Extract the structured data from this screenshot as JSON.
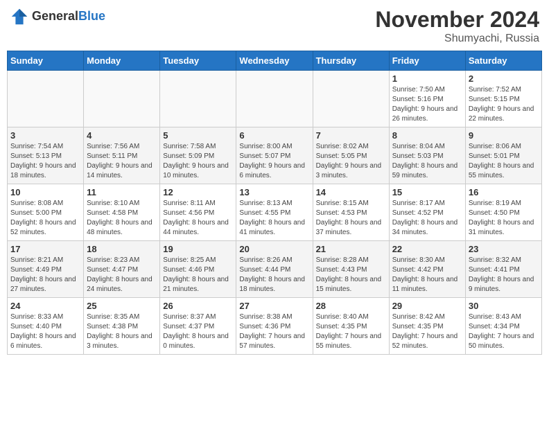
{
  "header": {
    "logo_general": "General",
    "logo_blue": "Blue",
    "month": "November 2024",
    "location": "Shumyachi, Russia"
  },
  "days_of_week": [
    "Sunday",
    "Monday",
    "Tuesday",
    "Wednesday",
    "Thursday",
    "Friday",
    "Saturday"
  ],
  "weeks": [
    [
      {
        "day": "",
        "info": ""
      },
      {
        "day": "",
        "info": ""
      },
      {
        "day": "",
        "info": ""
      },
      {
        "day": "",
        "info": ""
      },
      {
        "day": "",
        "info": ""
      },
      {
        "day": "1",
        "info": "Sunrise: 7:50 AM\nSunset: 5:16 PM\nDaylight: 9 hours and 26 minutes."
      },
      {
        "day": "2",
        "info": "Sunrise: 7:52 AM\nSunset: 5:15 PM\nDaylight: 9 hours and 22 minutes."
      }
    ],
    [
      {
        "day": "3",
        "info": "Sunrise: 7:54 AM\nSunset: 5:13 PM\nDaylight: 9 hours and 18 minutes."
      },
      {
        "day": "4",
        "info": "Sunrise: 7:56 AM\nSunset: 5:11 PM\nDaylight: 9 hours and 14 minutes."
      },
      {
        "day": "5",
        "info": "Sunrise: 7:58 AM\nSunset: 5:09 PM\nDaylight: 9 hours and 10 minutes."
      },
      {
        "day": "6",
        "info": "Sunrise: 8:00 AM\nSunset: 5:07 PM\nDaylight: 9 hours and 6 minutes."
      },
      {
        "day": "7",
        "info": "Sunrise: 8:02 AM\nSunset: 5:05 PM\nDaylight: 9 hours and 3 minutes."
      },
      {
        "day": "8",
        "info": "Sunrise: 8:04 AM\nSunset: 5:03 PM\nDaylight: 8 hours and 59 minutes."
      },
      {
        "day": "9",
        "info": "Sunrise: 8:06 AM\nSunset: 5:01 PM\nDaylight: 8 hours and 55 minutes."
      }
    ],
    [
      {
        "day": "10",
        "info": "Sunrise: 8:08 AM\nSunset: 5:00 PM\nDaylight: 8 hours and 52 minutes."
      },
      {
        "day": "11",
        "info": "Sunrise: 8:10 AM\nSunset: 4:58 PM\nDaylight: 8 hours and 48 minutes."
      },
      {
        "day": "12",
        "info": "Sunrise: 8:11 AM\nSunset: 4:56 PM\nDaylight: 8 hours and 44 minutes."
      },
      {
        "day": "13",
        "info": "Sunrise: 8:13 AM\nSunset: 4:55 PM\nDaylight: 8 hours and 41 minutes."
      },
      {
        "day": "14",
        "info": "Sunrise: 8:15 AM\nSunset: 4:53 PM\nDaylight: 8 hours and 37 minutes."
      },
      {
        "day": "15",
        "info": "Sunrise: 8:17 AM\nSunset: 4:52 PM\nDaylight: 8 hours and 34 minutes."
      },
      {
        "day": "16",
        "info": "Sunrise: 8:19 AM\nSunset: 4:50 PM\nDaylight: 8 hours and 31 minutes."
      }
    ],
    [
      {
        "day": "17",
        "info": "Sunrise: 8:21 AM\nSunset: 4:49 PM\nDaylight: 8 hours and 27 minutes."
      },
      {
        "day": "18",
        "info": "Sunrise: 8:23 AM\nSunset: 4:47 PM\nDaylight: 8 hours and 24 minutes."
      },
      {
        "day": "19",
        "info": "Sunrise: 8:25 AM\nSunset: 4:46 PM\nDaylight: 8 hours and 21 minutes."
      },
      {
        "day": "20",
        "info": "Sunrise: 8:26 AM\nSunset: 4:44 PM\nDaylight: 8 hours and 18 minutes."
      },
      {
        "day": "21",
        "info": "Sunrise: 8:28 AM\nSunset: 4:43 PM\nDaylight: 8 hours and 15 minutes."
      },
      {
        "day": "22",
        "info": "Sunrise: 8:30 AM\nSunset: 4:42 PM\nDaylight: 8 hours and 11 minutes."
      },
      {
        "day": "23",
        "info": "Sunrise: 8:32 AM\nSunset: 4:41 PM\nDaylight: 8 hours and 9 minutes."
      }
    ],
    [
      {
        "day": "24",
        "info": "Sunrise: 8:33 AM\nSunset: 4:40 PM\nDaylight: 8 hours and 6 minutes."
      },
      {
        "day": "25",
        "info": "Sunrise: 8:35 AM\nSunset: 4:38 PM\nDaylight: 8 hours and 3 minutes."
      },
      {
        "day": "26",
        "info": "Sunrise: 8:37 AM\nSunset: 4:37 PM\nDaylight: 8 hours and 0 minutes."
      },
      {
        "day": "27",
        "info": "Sunrise: 8:38 AM\nSunset: 4:36 PM\nDaylight: 7 hours and 57 minutes."
      },
      {
        "day": "28",
        "info": "Sunrise: 8:40 AM\nSunset: 4:35 PM\nDaylight: 7 hours and 55 minutes."
      },
      {
        "day": "29",
        "info": "Sunrise: 8:42 AM\nSunset: 4:35 PM\nDaylight: 7 hours and 52 minutes."
      },
      {
        "day": "30",
        "info": "Sunrise: 8:43 AM\nSunset: 4:34 PM\nDaylight: 7 hours and 50 minutes."
      }
    ]
  ]
}
